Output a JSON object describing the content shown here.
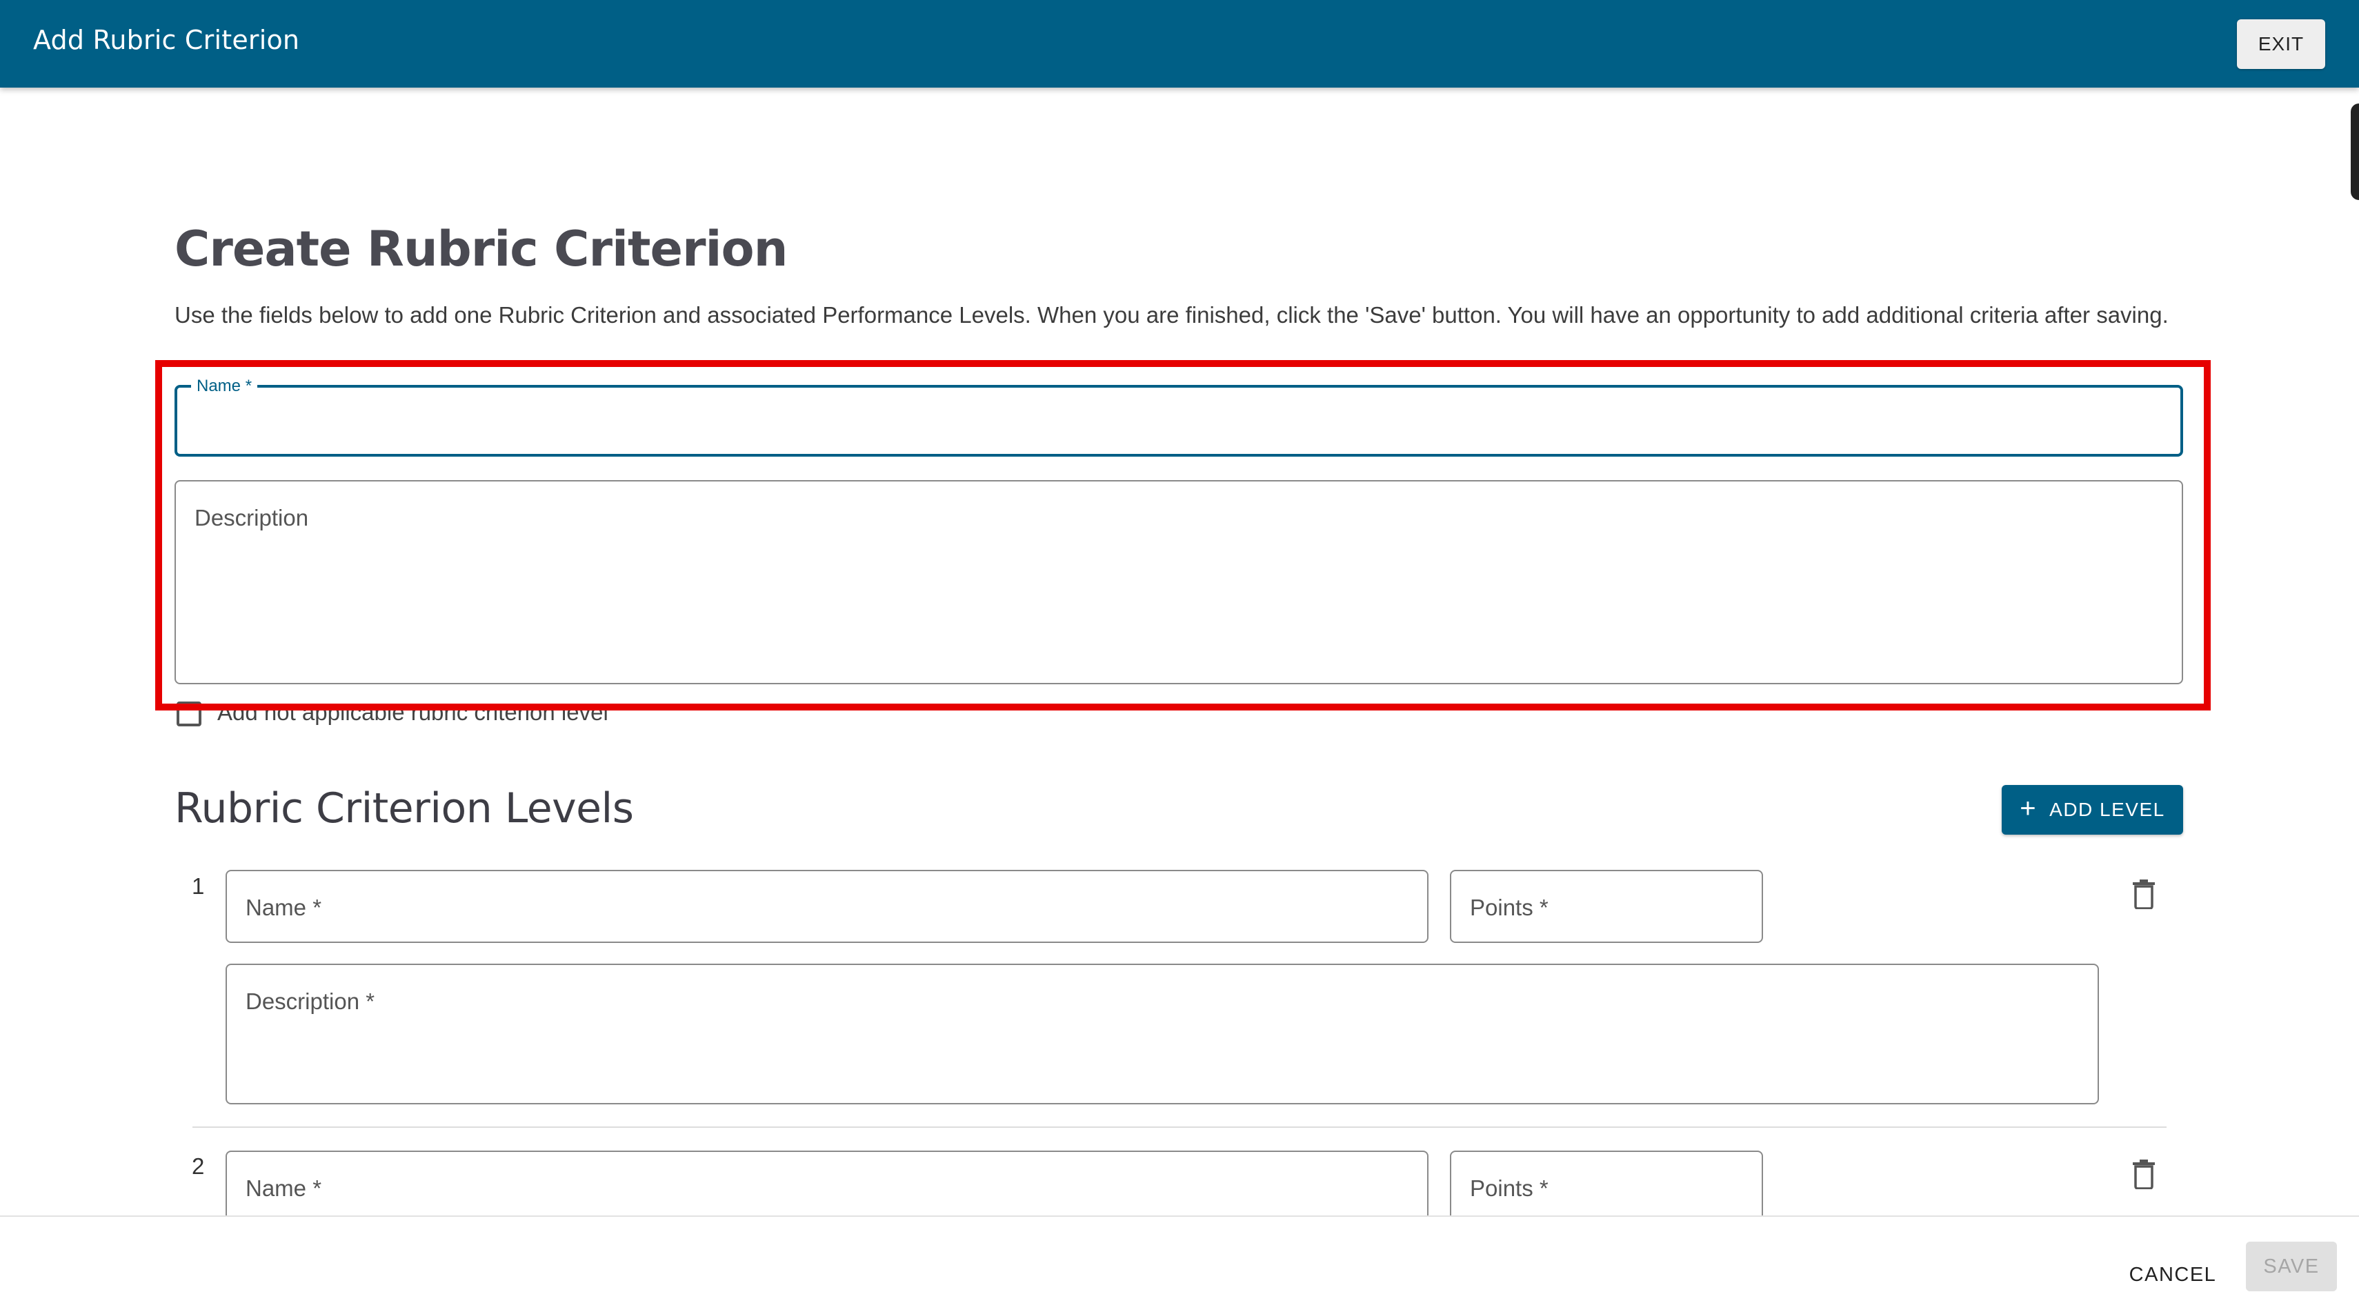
{
  "header": {
    "title": "Add Rubric Criterion",
    "exit_label": "EXIT"
  },
  "page": {
    "title": "Create Rubric Criterion",
    "intro": "Use the fields below to add one Rubric Criterion and associated Performance Levels. When you are finished, click the 'Save' button. You will have an opportunity to add additional criteria after saving."
  },
  "criterion": {
    "name_label": "Name",
    "description_label": "Description",
    "not_applicable_label": "Add not applicable rubric criterion level",
    "not_applicable_checked": false
  },
  "levels_section": {
    "title": "Rubric Criterion Levels",
    "add_level_label": "ADD LEVEL",
    "levels": [
      {
        "number": "1",
        "name_label": "Name",
        "points_label": "Points",
        "description_label": "Description"
      },
      {
        "number": "2",
        "name_label": "Name",
        "points_label": "Points"
      }
    ]
  },
  "footer": {
    "cancel_label": "CANCEL",
    "save_label": "SAVE"
  },
  "required_marker": "*",
  "colors": {
    "primary": "#005f86",
    "highlight": "#e60000"
  }
}
